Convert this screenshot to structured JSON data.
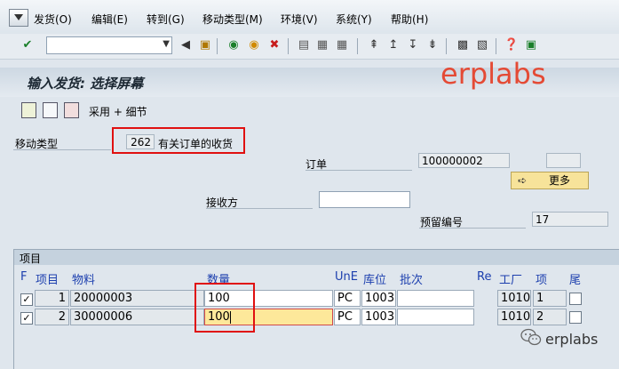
{
  "menu": [
    "发货(O)",
    "编辑(E)",
    "转到(G)",
    "移动类型(M)",
    "环境(V)",
    "系统(Y)",
    "帮助(H)"
  ],
  "toolbar": {
    "command_value": ""
  },
  "title": "输入发货: 选择屏幕",
  "watermark": "erplabs",
  "app_toolbar": {
    "adopt_label": "采用 + 细节"
  },
  "header": {
    "movement_type_label": "移动类型",
    "movement_type_value": "262",
    "movement_type_desc": "有关订单的收货",
    "order_label": "订单",
    "order_value": "100000002",
    "order_extra": "",
    "more_button": "更多",
    "recipient_label": "接收方",
    "recipient_value": "",
    "reservation_label": "预留编号",
    "reservation_value": "17"
  },
  "items": {
    "section_title": "项目",
    "columns": {
      "f": "F",
      "item": "项目",
      "material": "物料",
      "qty": "数量",
      "une": "UnE",
      "sloc": "库位",
      "batch": "批次",
      "re": "Re",
      "plant": "工厂",
      "pos": "项",
      "tail": "尾"
    },
    "rows": [
      {
        "item": "1",
        "material": "20000003",
        "qty": "100",
        "une": "PC",
        "sloc": "1003",
        "batch": "",
        "plant": "1010",
        "pos": "1",
        "checked": true
      },
      {
        "item": "2",
        "material": "30000006",
        "qty": "100",
        "une": "PC",
        "sloc": "1003",
        "batch": "",
        "plant": "1010",
        "pos": "2",
        "checked": true
      }
    ]
  },
  "footer_watermark": "erplabs",
  "colors": {
    "highlight": "#e01010",
    "editing": "#fde89a",
    "header_blue": "#1c3fae"
  }
}
